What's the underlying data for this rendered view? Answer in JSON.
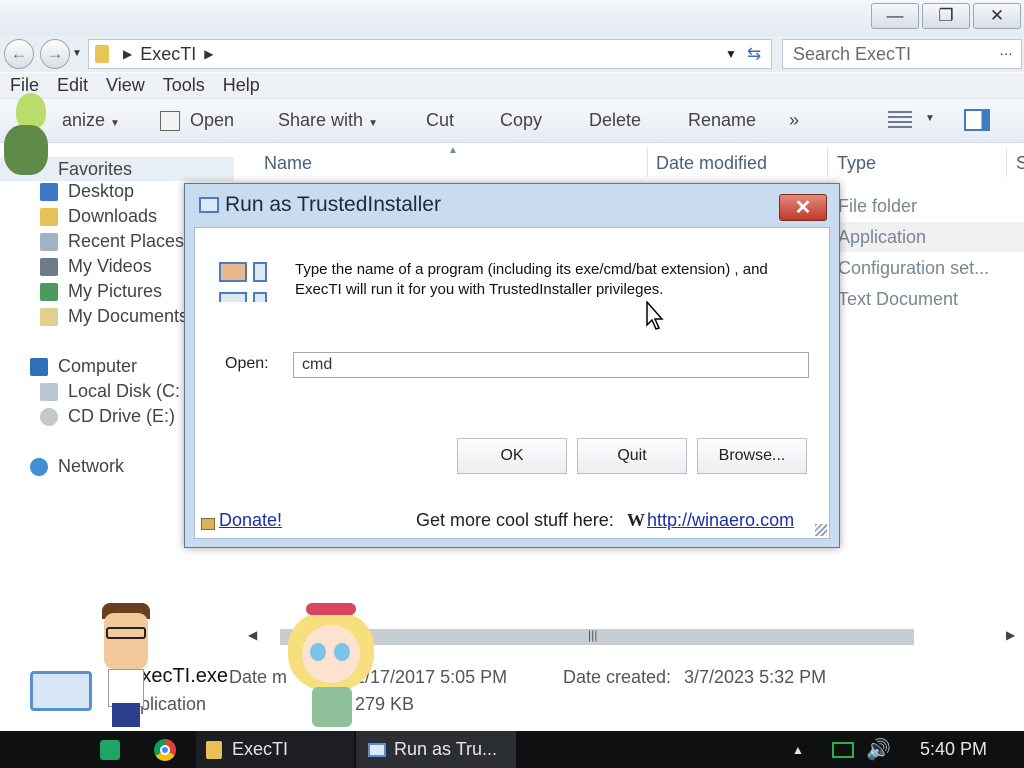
{
  "window": {
    "controls": {
      "minimize": "—",
      "restore": "❐",
      "close": "✕"
    },
    "breadcrumb": {
      "arrow": "▶",
      "folder": "ExecTI",
      "trailing_arrow": "▶"
    },
    "search_placeholder": "Search ExecTI",
    "menu": [
      "File",
      "Edit",
      "View",
      "Tools",
      "Help"
    ]
  },
  "toolbar": {
    "organize": "anize",
    "open": "Open",
    "share_with": "Share with",
    "cut": "Cut",
    "copy": "Copy",
    "delete": "Delete",
    "rename": "Rename",
    "more": "»"
  },
  "sidebar": {
    "favorites": "Favorites",
    "favorites_items": [
      "Desktop",
      "Downloads",
      "Recent Places",
      "My Videos",
      "My Pictures",
      "My Documents"
    ],
    "computer": "Computer",
    "computer_items": [
      "Local Disk (C:",
      "CD Drive (E:)"
    ],
    "network": "Network"
  },
  "file_list": {
    "columns": [
      "Name",
      "Date modified",
      "Type",
      "S"
    ],
    "types": [
      "File folder",
      "Application",
      "Configuration set...",
      "Text Document"
    ]
  },
  "details": {
    "name": "ExecTI.exe",
    "type": "Application",
    "date_modified_label": "Date m",
    "date_modified": "1/17/2017 5:05 PM",
    "date_created_label": "Date created:",
    "date_created": "3/7/2023 5:32 PM",
    "size": "279 KB"
  },
  "dialog": {
    "title": "Run as TrustedInstaller",
    "close": "✕",
    "message": "Type the name of a program (including its exe/cmd/bat extension) , and ExecTI will run it for you with TrustedInstaller privileges.",
    "open_label": "Open:",
    "open_value": "cmd",
    "ok": "OK",
    "quit": "Quit",
    "browse": "Browse...",
    "donate": "Donate!",
    "promo_text": "Get more cool stuff here:",
    "promo_w": "W",
    "promo_link": "http://winaero.com"
  },
  "taskbar": {
    "explorer_task": "ExecTI",
    "dialog_task": "Run as Tru...",
    "tray_arrow": "▲",
    "clock": "5:40 PM"
  },
  "colors": {
    "dialog_frame": "#c9dcef",
    "close_red": "#c0392b",
    "link_blue": "#1d2ea8",
    "taskbar": "#0f1012"
  }
}
